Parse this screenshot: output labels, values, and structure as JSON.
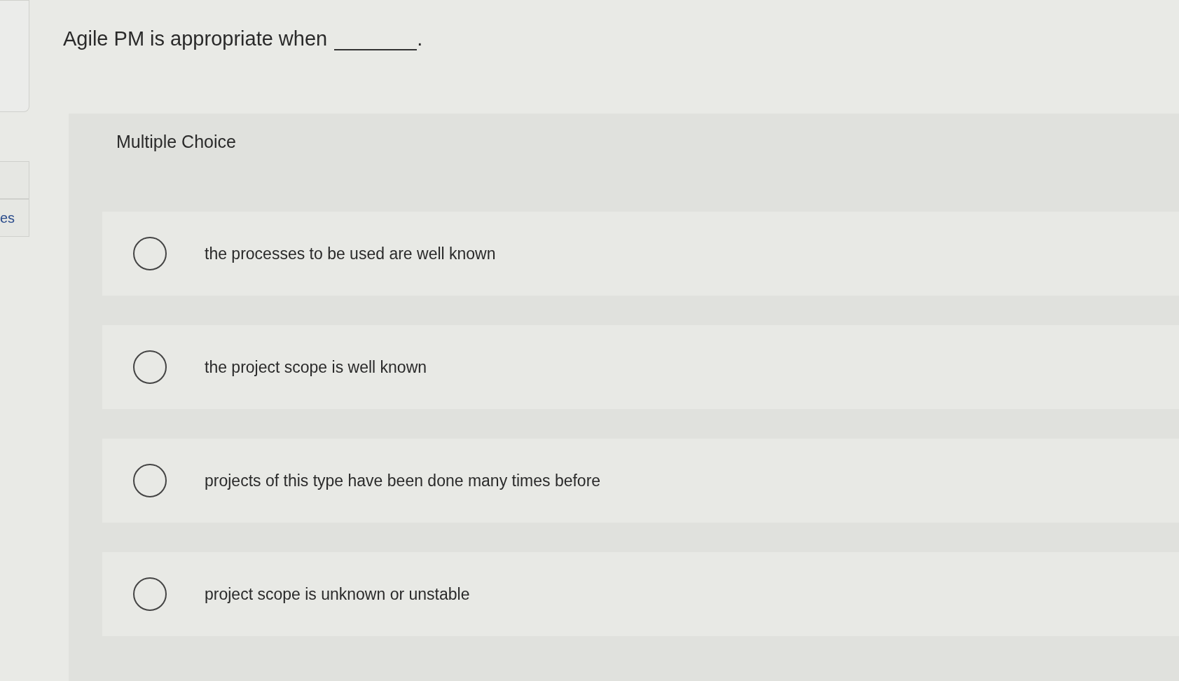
{
  "sidebar": {
    "tab_label": "es"
  },
  "question": {
    "text": "Agile PM is appropriate when",
    "end": "."
  },
  "panel": {
    "heading": "Multiple Choice"
  },
  "options": [
    {
      "label": "the processes to be used are well known",
      "selected": false
    },
    {
      "label": "the project scope is well known",
      "selected": false
    },
    {
      "label": "projects of this type have been done many times before",
      "selected": false
    },
    {
      "label": "project scope is unknown or unstable",
      "selected": false
    }
  ]
}
